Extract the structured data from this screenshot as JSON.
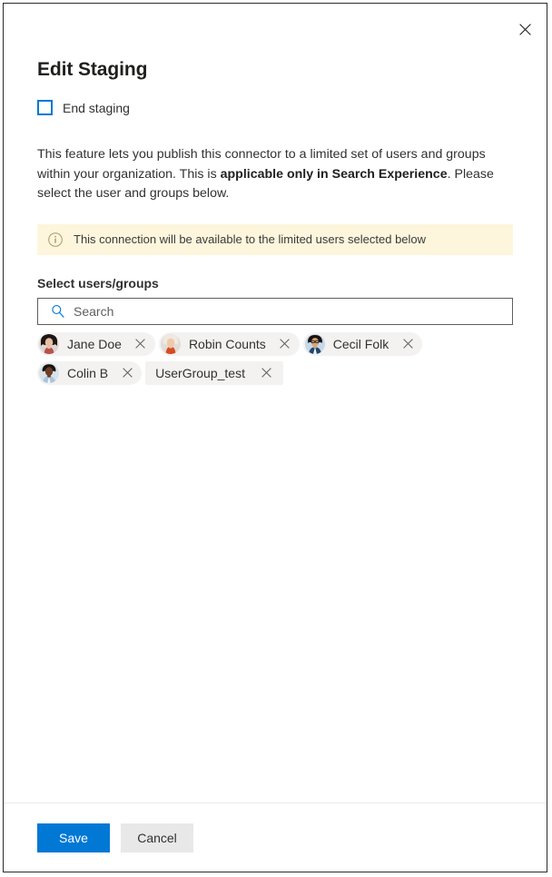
{
  "dialog": {
    "title": "Edit Staging",
    "close_label": "Close",
    "close_icon": "close-icon"
  },
  "end_staging": {
    "label": "End staging",
    "checked": false
  },
  "description": {
    "part1": "This feature lets you publish this connector to a limited set of users and groups within your organization. This is ",
    "emphasis": "applicable only in Search Experience",
    "part2": ". Please select the user and groups below."
  },
  "info_banner": {
    "icon": "info-circle-icon",
    "text": "This connection will be available to the limited users selected below",
    "background_color": "#fdf6dd",
    "icon_color": "#a19060"
  },
  "selector": {
    "label": "Select users/groups",
    "search": {
      "icon": "search-icon",
      "placeholder": "Search",
      "value": ""
    },
    "chips": [
      {
        "name": "Jane Doe",
        "type": "person",
        "remove_icon": "close-icon"
      },
      {
        "name": "Robin Counts",
        "type": "person",
        "remove_icon": "close-icon"
      },
      {
        "name": "Cecil Folk",
        "type": "person",
        "remove_icon": "close-icon"
      },
      {
        "name": "Colin B",
        "type": "person",
        "remove_icon": "close-icon"
      },
      {
        "name": "UserGroup_test",
        "type": "group",
        "remove_icon": "close-icon"
      }
    ]
  },
  "footer": {
    "save_label": "Save",
    "cancel_label": "Cancel",
    "primary_color": "#0078d4"
  }
}
